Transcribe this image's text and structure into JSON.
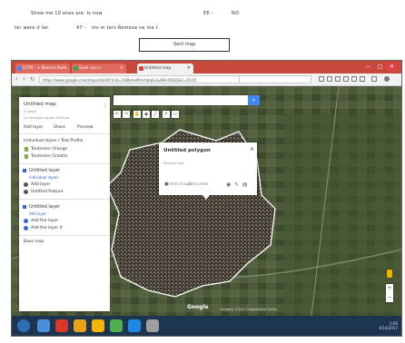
{
  "document": {
    "line1": "Show me 10 ones are: Is now",
    "line1_code": "EE -",
    "line1_val": "NO",
    "line2": "ter were it ter",
    "line2_code": "47 -",
    "line2_rest": "ms m ters Remove ne me t",
    "button_label": "Sent map"
  },
  "browser": {
    "tabs": [
      {
        "label": "ICTM - + Bemen Nor..."
      },
      {
        "label": "Geel uns n"
      },
      {
        "label": "Untitled map"
      }
    ],
    "url": "https://www.google.com/maps/d/edit?mid=1zBbmeMmshbqGaLy8HnQSSQ&ll=26.05",
    "search_placeholder": "",
    "win_controls": [
      "—",
      "□",
      "✕"
    ],
    "colors": {
      "tabbar": "#c8483c",
      "taskbar": "#1e3550",
      "accent": "#4285f4"
    }
  },
  "panel": {
    "title": "Untitled map",
    "subtitle": "0 views",
    "saved": "All changes saved in Drive",
    "actions": [
      "Add layer",
      "Share",
      "Preview"
    ],
    "layer_row": "Individual styles / Text Profile",
    "items_top": [
      "Tontinnen Orange",
      "Tontinnen Greatla"
    ],
    "layer1_title": "Untitled layer",
    "layer1_sub": "Individual styles",
    "layer1_items": [
      "Add layer",
      "Untitled feature"
    ],
    "layer2_title": "Untitled layer",
    "layer2_sub": "Add layer",
    "layer2_items": [
      "Add the layer",
      "Add the layer it"
    ],
    "basemap": "Base map"
  },
  "popup": {
    "title": "Untitled polygon",
    "desc": "Sample line",
    "action_left": "Add image",
    "action_right": "Add video"
  },
  "map": {
    "google_logo": "Google",
    "attribution": "Imagery ©2017 DigitalGlobe  Terms"
  },
  "taskbar": {
    "tray_time": "2:06",
    "tray_date": "6/14/2017"
  }
}
